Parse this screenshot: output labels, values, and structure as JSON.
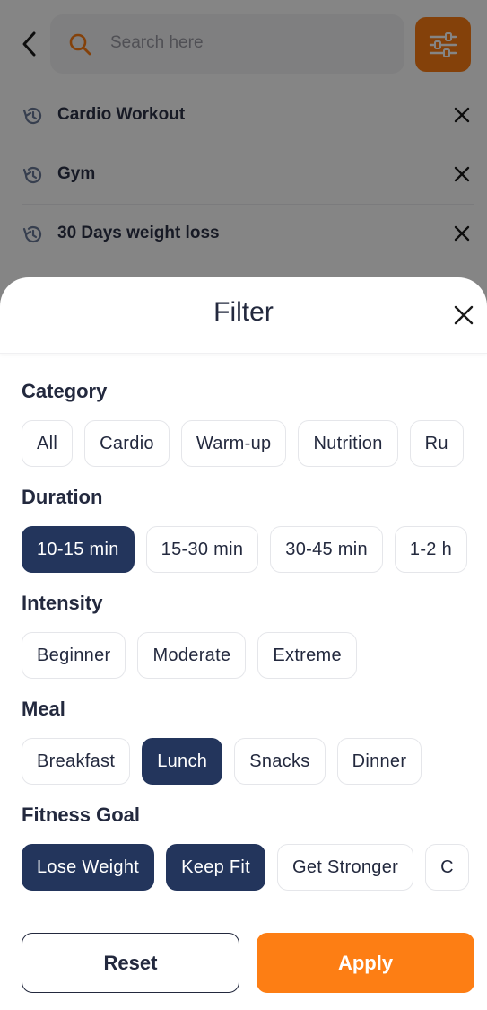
{
  "search": {
    "placeholder": "Search here"
  },
  "history": [
    {
      "label": "Cardio Workout"
    },
    {
      "label": "Gym"
    },
    {
      "label": "30 Days weight loss"
    }
  ],
  "filter": {
    "title": "Filter",
    "sections": {
      "category": {
        "title": "Category",
        "chips": [
          "All",
          "Cardio",
          "Warm-up",
          "Nutrition",
          "Ru"
        ]
      },
      "duration": {
        "title": "Duration",
        "chips": [
          "10-15 min",
          "15-30 min",
          "30-45 min",
          "1-2 h"
        ],
        "selected": [
          "10-15 min"
        ]
      },
      "intensity": {
        "title": "Intensity",
        "chips": [
          "Beginner",
          "Moderate",
          "Extreme"
        ]
      },
      "meal": {
        "title": "Meal",
        "chips": [
          "Breakfast",
          "Lunch",
          "Snacks",
          "Dinner"
        ],
        "selected": [
          "Lunch"
        ]
      },
      "fitness_goal": {
        "title": "Fitness Goal",
        "chips": [
          "Lose Weight",
          "Keep Fit",
          "Get Stronger",
          "C"
        ],
        "selected": [
          "Lose Weight",
          "Keep Fit"
        ]
      }
    },
    "reset_label": "Reset",
    "apply_label": "Apply"
  },
  "colors": {
    "accent": "#fd7e14",
    "selected_chip": "#23355c",
    "text_dark": "#23293e"
  },
  "icons": {
    "back": "chevron-left-icon",
    "search": "search-icon",
    "filter": "sliders-icon",
    "history": "history-icon",
    "close": "close-icon"
  }
}
